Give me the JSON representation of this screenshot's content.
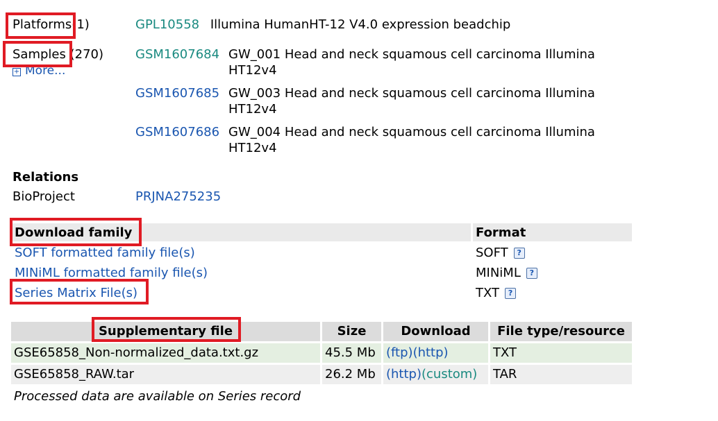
{
  "platforms": {
    "label": "Platforms",
    "count": "(1)",
    "items": [
      {
        "id": "GPL10558",
        "title": "Illumina HumanHT-12 V4.0 expression beadchip"
      }
    ]
  },
  "samples": {
    "label": "Samples",
    "count": "(270)",
    "more": "More...",
    "items": [
      {
        "id": "GSM1607684",
        "title_line1": "GW_001 Head and neck squamous cell carcinoma Illumina",
        "title_line2": "HT12v4"
      },
      {
        "id": "GSM1607685",
        "title_line1": "GW_003 Head and neck squamous cell carcinoma Illumina",
        "title_line2": "HT12v4"
      },
      {
        "id": "GSM1607686",
        "title_line1": "GW_004 Head and neck squamous cell carcinoma Illumina",
        "title_line2": "HT12v4"
      }
    ]
  },
  "relations": {
    "heading": "Relations",
    "bioproject_label": "BioProject",
    "bioproject_id": "PRJNA275235"
  },
  "download_family": {
    "heading": "Download family",
    "format_heading": "Format",
    "rows": [
      {
        "label": "SOFT formatted family file(s)",
        "format": "SOFT"
      },
      {
        "label": "MINiML formatted family file(s)",
        "format": "MINiML"
      },
      {
        "label": "Series Matrix File(s)",
        "format": "TXT"
      }
    ],
    "help_glyph": "?"
  },
  "supplementary": {
    "headers": [
      "Supplementary file",
      "Size",
      "Download",
      "File type/resource"
    ],
    "rows": [
      {
        "file": "GSE65858_Non-normalized_data.txt.gz",
        "size": "45.5 Mb",
        "dl1": "(ftp)",
        "dl2": "(http)",
        "type": "TXT"
      },
      {
        "file": "GSE65858_RAW.tar",
        "size": "26.2 Mb",
        "dl1": "(http)",
        "dl2": "(custom)",
        "type": "TAR"
      }
    ],
    "note": "Processed data are available on Series record"
  },
  "colors": {
    "highlight_box": "#e01b24",
    "link": "#1a56b0",
    "visited_link": "#1a8a80"
  }
}
